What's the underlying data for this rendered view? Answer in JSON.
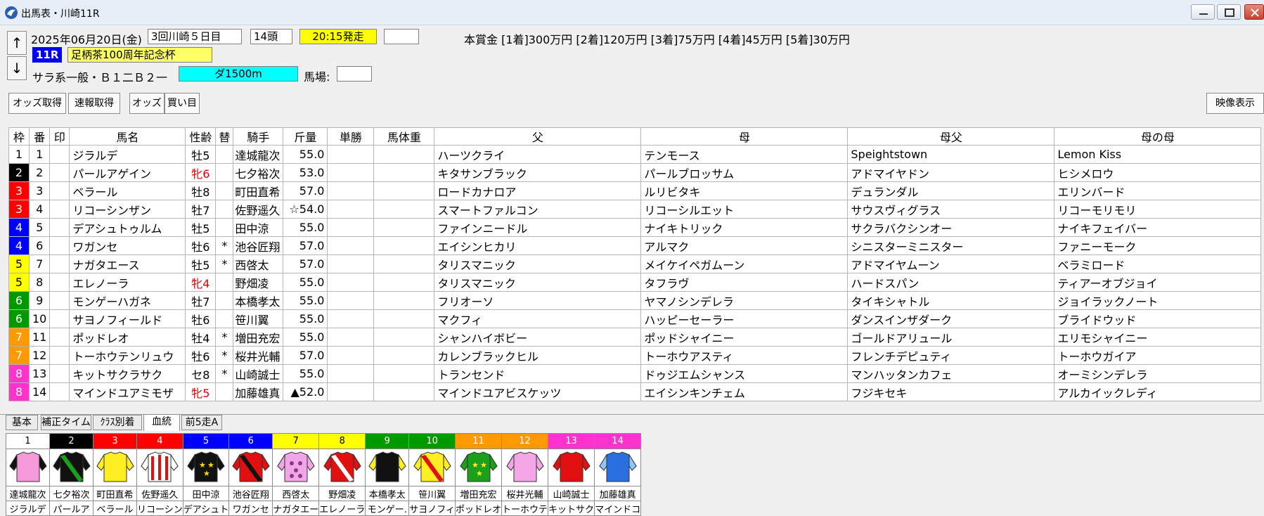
{
  "window": {
    "title": "出馬表・川崎11R"
  },
  "race": {
    "date": "2025年06月20日(金)",
    "meeting": "3回川崎５日目",
    "heads": "14頭",
    "start_time": "20:15発走",
    "race_no": "11R",
    "race_name": "足柄茶100周年記念杯",
    "condition": "サラ系一般・Ｂ１二Ｂ２一",
    "distance": "ダ1500m",
    "baba_label": "馬場:",
    "prize": "本賞金 [1着]300万円 [2着]120万円 [3着]75万円 [4着]45万円 [5着]30万円"
  },
  "nav": {
    "up": "↑",
    "down": "↓"
  },
  "toolbar": {
    "odds_fetch": "オッズ取得",
    "result_fetch": "速報取得",
    "odds": "オッズ",
    "bets": "買い目",
    "video": "映像表示"
  },
  "columns": [
    "枠",
    "番",
    "印",
    "馬名",
    "性齢",
    "替",
    "騎手",
    "斤量",
    "単勝",
    "馬体重",
    "父",
    "母",
    "母父",
    "母の母"
  ],
  "frame_colors": {
    "1": "#ffffff",
    "2": "#000000",
    "3": "#ff0000",
    "4": "#0000ff",
    "5": "#ffff00",
    "6": "#009900",
    "7": "#ff9900",
    "8": "#ff33cc"
  },
  "frame_text_colors": {
    "1": "#000000",
    "2": "#ffffff",
    "3": "#ffffff",
    "4": "#ffffff",
    "5": "#000000",
    "6": "#ffffff",
    "7": "#ffffff",
    "8": "#ffffff"
  },
  "horses": [
    {
      "waku": "1",
      "no": "1",
      "name": "ジラルデ",
      "sex_age": "牡5",
      "mare": false,
      "kae": "",
      "jockey": "達城龍次",
      "weight": "55.0",
      "sire": "ハーツクライ",
      "dam": "テンモース",
      "dam_sire": "Speightstown",
      "dam_dam": "Lemon Kiss"
    },
    {
      "waku": "2",
      "no": "2",
      "name": "パールアゲイン",
      "sex_age": "牝6",
      "mare": true,
      "kae": "",
      "jockey": "七夕裕次",
      "weight": "53.0",
      "sire": "キタサンブラック",
      "dam": "パールブロッサム",
      "dam_sire": "アドマイヤドン",
      "dam_dam": "ヒシメロウ"
    },
    {
      "waku": "3",
      "no": "3",
      "name": "ベラール",
      "sex_age": "牡8",
      "mare": false,
      "kae": "",
      "jockey": "町田直希",
      "weight": "57.0",
      "sire": "ロードカナロア",
      "dam": "ルリビタキ",
      "dam_sire": "デュランダル",
      "dam_dam": "エリンバード"
    },
    {
      "waku": "3",
      "no": "4",
      "name": "リコーシンザン",
      "sex_age": "牡7",
      "mare": false,
      "kae": "",
      "jockey": "佐野遥久",
      "weight": "☆54.0",
      "sire": "スマートファルコン",
      "dam": "リコーシルエット",
      "dam_sire": "サウスヴィグラス",
      "dam_dam": "リコーモリモリ"
    },
    {
      "waku": "4",
      "no": "5",
      "name": "デアシュトゥルム",
      "sex_age": "牡5",
      "mare": false,
      "kae": "",
      "jockey": "田中涼",
      "weight": "55.0",
      "sire": "ファインニードル",
      "dam": "ナイキトリック",
      "dam_sire": "サクラバクシンオー",
      "dam_dam": "ナイキフェイバー"
    },
    {
      "waku": "4",
      "no": "6",
      "name": "ワガンセ",
      "sex_age": "牡6",
      "mare": false,
      "kae": "*",
      "jockey": "池谷匠翔",
      "weight": "57.0",
      "sire": "エイシンヒカリ",
      "dam": "アルマク",
      "dam_sire": "シニスターミニスター",
      "dam_dam": "ファニーモーク"
    },
    {
      "waku": "5",
      "no": "7",
      "name": "ナガタエース",
      "sex_age": "牡5",
      "mare": false,
      "kae": "*",
      "jockey": "西啓太",
      "weight": "57.0",
      "sire": "タリスマニック",
      "dam": "メイケイペガムーン",
      "dam_sire": "アドマイヤムーン",
      "dam_dam": "ベラミロード"
    },
    {
      "waku": "5",
      "no": "8",
      "name": "エレノーラ",
      "sex_age": "牝4",
      "mare": true,
      "kae": "",
      "jockey": "野畑凌",
      "weight": "55.0",
      "sire": "タリスマニック",
      "dam": "タフラヴ",
      "dam_sire": "ハードスパン",
      "dam_dam": "ティアーオブジョイ"
    },
    {
      "waku": "6",
      "no": "9",
      "name": "モンゲーハガネ",
      "sex_age": "牡7",
      "mare": false,
      "kae": "",
      "jockey": "本橋孝太",
      "weight": "55.0",
      "sire": "フリオーソ",
      "dam": "ヤマノシンデレラ",
      "dam_sire": "タイキシャトル",
      "dam_dam": "ジョイラックノート"
    },
    {
      "waku": "6",
      "no": "10",
      "name": "サヨノフィールド",
      "sex_age": "牡6",
      "mare": false,
      "kae": "",
      "jockey": "笹川翼",
      "weight": "55.0",
      "sire": "マクフィ",
      "dam": "ハッピーセーラー",
      "dam_sire": "ダンスインザダーク",
      "dam_dam": "ブライドウッド"
    },
    {
      "waku": "7",
      "no": "11",
      "name": "ポッドレオ",
      "sex_age": "牡4",
      "mare": false,
      "kae": "*",
      "jockey": "増田充宏",
      "weight": "55.0",
      "sire": "シャンハイボビー",
      "dam": "ポッドシャイニー",
      "dam_sire": "ゴールドアリュール",
      "dam_dam": "エリモシャイニー"
    },
    {
      "waku": "7",
      "no": "12",
      "name": "トーホウテンリュウ",
      "sex_age": "牡6",
      "mare": false,
      "kae": "*",
      "jockey": "桜井光輔",
      "weight": "57.0",
      "sire": "カレンブラックヒル",
      "dam": "トーホウアスティ",
      "dam_sire": "フレンチデピュティ",
      "dam_dam": "トーホウガイア"
    },
    {
      "waku": "8",
      "no": "13",
      "name": "キットサクラサク",
      "sex_age": "セ8",
      "mare": false,
      "kae": "*",
      "jockey": "山崎誠士",
      "weight": "55.0",
      "sire": "トランセンド",
      "dam": "ドゥジエムシャンス",
      "dam_sire": "マンハッタンカフェ",
      "dam_dam": "オーミシンデレラ"
    },
    {
      "waku": "8",
      "no": "14",
      "name": "マインドユアミモザ",
      "sex_age": "牝5",
      "mare": true,
      "kae": "",
      "jockey": "加藤雄真",
      "weight": "▲52.0",
      "sire": "マインドユアビスケッツ",
      "dam": "エイシンキンチェム",
      "dam_sire": "フジキセキ",
      "dam_dam": "アルカイックレディ"
    }
  ],
  "tabs": [
    "基本",
    "補正タイム",
    "ｸﾗｽ別着",
    "血統",
    "前5走A"
  ],
  "active_tab": 3,
  "silks": [
    {
      "no": "1",
      "jockey": "達城龍次",
      "horse": "ジラルデ",
      "body": "#f59ad8",
      "accent": "#111111",
      "pattern": "plain"
    },
    {
      "no": "2",
      "jockey": "七夕裕次",
      "horse": "パールア",
      "body": "#111111",
      "accent": "#1aa01a",
      "pattern": "sash"
    },
    {
      "no": "3",
      "jockey": "町田直希",
      "horse": "ベラール",
      "body": "#ffee22",
      "accent": "#ffee22",
      "pattern": "plain"
    },
    {
      "no": "4",
      "jockey": "佐野遥久",
      "horse": "リコーシン",
      "body": "#ffffff",
      "accent": "#e01010",
      "pattern": "stripes"
    },
    {
      "no": "5",
      "jockey": "田中涼",
      "horse": "デアシュト",
      "body": "#111111",
      "accent": "#ffd800",
      "pattern": "stars"
    },
    {
      "no": "6",
      "jockey": "池谷匠翔",
      "horse": "ワガンセ",
      "body": "#e01010",
      "accent": "#111111",
      "pattern": "sash"
    },
    {
      "no": "7",
      "jockey": "西啓太",
      "horse": "ナガタエー",
      "body": "#f2a6e8",
      "accent": "#8a3a8a",
      "pattern": "dots"
    },
    {
      "no": "8",
      "jockey": "野畑凌",
      "horse": "エレノーラ",
      "body": "#e01010",
      "accent": "#ffffff",
      "pattern": "sash"
    },
    {
      "no": "9",
      "jockey": "本橋孝太",
      "horse": "モンゲー.",
      "body": "#111111",
      "accent": "#ffee22",
      "pattern": "plain"
    },
    {
      "no": "10",
      "jockey": "笹川翼",
      "horse": "サヨノフィ",
      "body": "#ffee22",
      "accent": "#e01010",
      "pattern": "sash"
    },
    {
      "no": "11",
      "jockey": "増田充宏",
      "horse": "ポッドレオ",
      "body": "#1aa01a",
      "accent": "#ffee22",
      "pattern": "stars"
    },
    {
      "no": "12",
      "jockey": "桜井光輔",
      "horse": "トーホウテ",
      "body": "#f5a6e6",
      "accent": "#f5a6e6",
      "pattern": "plain"
    },
    {
      "no": "13",
      "jockey": "山崎誠士",
      "horse": "キットサク",
      "body": "#e01010",
      "accent": "#e01010",
      "pattern": "plain"
    },
    {
      "no": "14",
      "jockey": "加藤雄真",
      "horse": "マインドコ",
      "body": "#2a6fe0",
      "accent": "#8cc8ff",
      "pattern": "plain"
    }
  ]
}
